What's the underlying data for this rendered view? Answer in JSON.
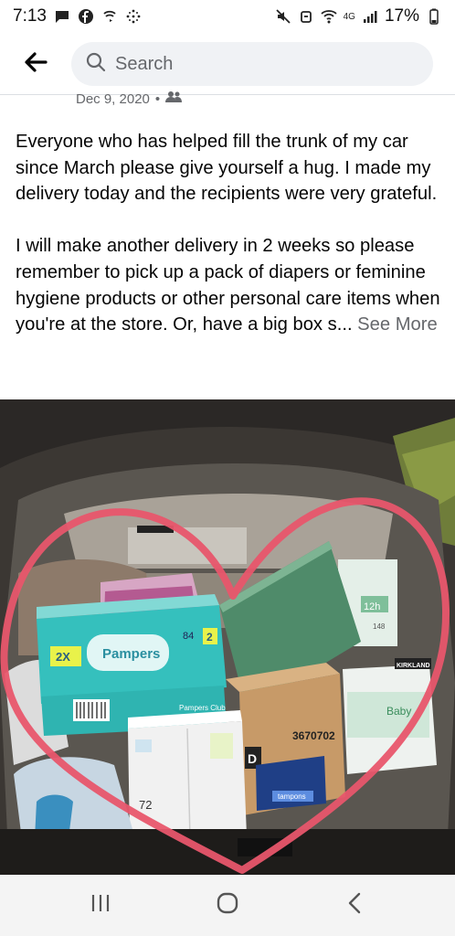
{
  "status_bar": {
    "time": "7:13",
    "network": "4G",
    "battery": "17%",
    "left_icons": [
      "chat-icon",
      "facebook-icon",
      "wifi-call-icon",
      "grid-dots-icon"
    ],
    "right_icons": [
      "mute-icon",
      "alarm-icon",
      "wifi-icon",
      "signal-icon",
      "battery-icon"
    ]
  },
  "header": {
    "back_icon": "arrow-left-icon",
    "search_placeholder": "Search"
  },
  "post": {
    "date": "Dec 9, 2020",
    "separator": "•",
    "privacy_icon": "group-icon",
    "paragraph_1": "Everyone who has helped fill the trunk of my car since March please give yourself a hug.  I made my delivery today and the recipients were very grateful.",
    "paragraph_2": "I will make another delivery in 2 weeks so please remember to pick up a pack of diapers or feminine hygiene products or other personal care items when you're at the store. Or, have a big box s...",
    "see_more": "See More"
  },
  "photo": {
    "labels": {
      "pampers": "Pampers",
      "pampers_2x": "2X",
      "pampers_count": "84",
      "pampers_size": "2",
      "pampers_side": "Pampers Club",
      "kirkland": "KIRKLAND",
      "baby": "Baby",
      "count_12h": "12h",
      "count_148": "148",
      "box_number": "3670702",
      "box_letter": "D",
      "tampons": "tampons",
      "count_72": "72"
    }
  },
  "nav_bar": {
    "recents_icon": "recent-apps-icon",
    "home_icon": "home-icon",
    "back_icon": "back-chevron-icon"
  }
}
